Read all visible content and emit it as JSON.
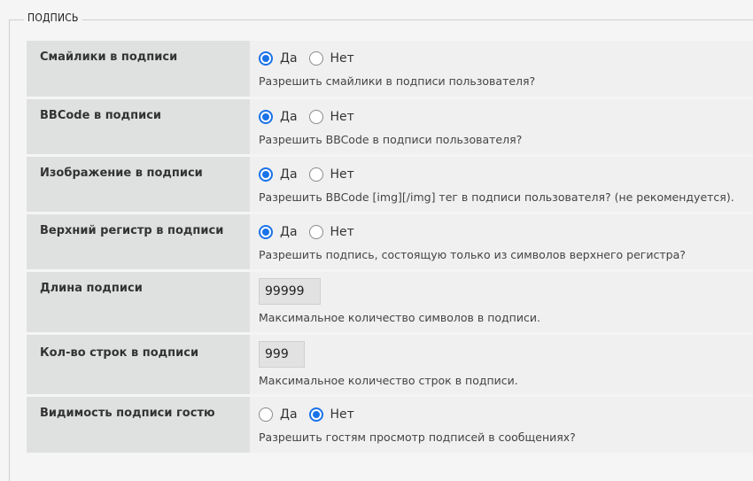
{
  "section": {
    "legend": "ПОДПИСЬ"
  },
  "rows": [
    {
      "label": "Смайлики в подписи",
      "type": "radio",
      "yes": "Да",
      "no": "Нет",
      "selected": "yes",
      "hint": "Разрешить смайлики в подписи пользователя?"
    },
    {
      "label": "BBCode в подписи",
      "type": "radio",
      "yes": "Да",
      "no": "Нет",
      "selected": "yes",
      "hint": "Разрешить BBCode в подписи пользователя?"
    },
    {
      "label": "Изображение в подписи",
      "type": "radio",
      "yes": "Да",
      "no": "Нет",
      "selected": "yes",
      "hint": "Разрешить BBCode [img][/img] тег в подписи пользователя? (не рекомендуется)."
    },
    {
      "label": "Верхний регистр в подписи",
      "type": "radio",
      "yes": "Да",
      "no": "Нет",
      "selected": "yes",
      "hint": "Разрешить подпись, состоящую только из символов верхнего регистра?"
    },
    {
      "label": "Длина подписи",
      "type": "input",
      "value": "99999",
      "hint": "Максимальное количество символов в подписи."
    },
    {
      "label": "Кол-во строк в подписи",
      "type": "input",
      "value": "999",
      "hint": "Максимальное количество строк в подписи."
    },
    {
      "label": "Видимость подписи гостю",
      "type": "radio",
      "yes": "Да",
      "no": "Нет",
      "selected": "no",
      "hint": "Разрешить гостям просмотр подписей в сообщениях?"
    }
  ],
  "colors": {
    "accent": "#1a73e8",
    "label_bg": "#dfe1e0",
    "value_bg": "#f0f0f0"
  }
}
